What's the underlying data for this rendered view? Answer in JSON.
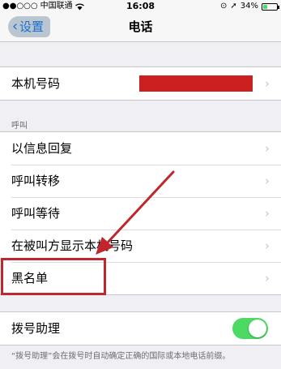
{
  "status_bar": {
    "signal": "●●○○○",
    "carrier": "中国联通",
    "time": "16:08",
    "battery_percent": "34%",
    "battery_level": 0.34
  },
  "nav": {
    "back_label": "设置",
    "title": "电话"
  },
  "my_number": {
    "label": "本机号码"
  },
  "calls_section": {
    "header": "呼叫",
    "items": [
      {
        "label": "以信息回复"
      },
      {
        "label": "呼叫转移"
      },
      {
        "label": "呼叫等待"
      },
      {
        "label": "在被叫方显示本机号码"
      },
      {
        "label": "黑名单"
      }
    ]
  },
  "dial_assist": {
    "label": "拨号助理",
    "enabled": true,
    "footer": "“拨号助理”会在拨号时自动确定正确的国际或本地电话前缀。"
  },
  "colors": {
    "toggle_on": "#4cd964",
    "annotation_red": "#c0262c",
    "link_blue": "#1a6fd1"
  }
}
